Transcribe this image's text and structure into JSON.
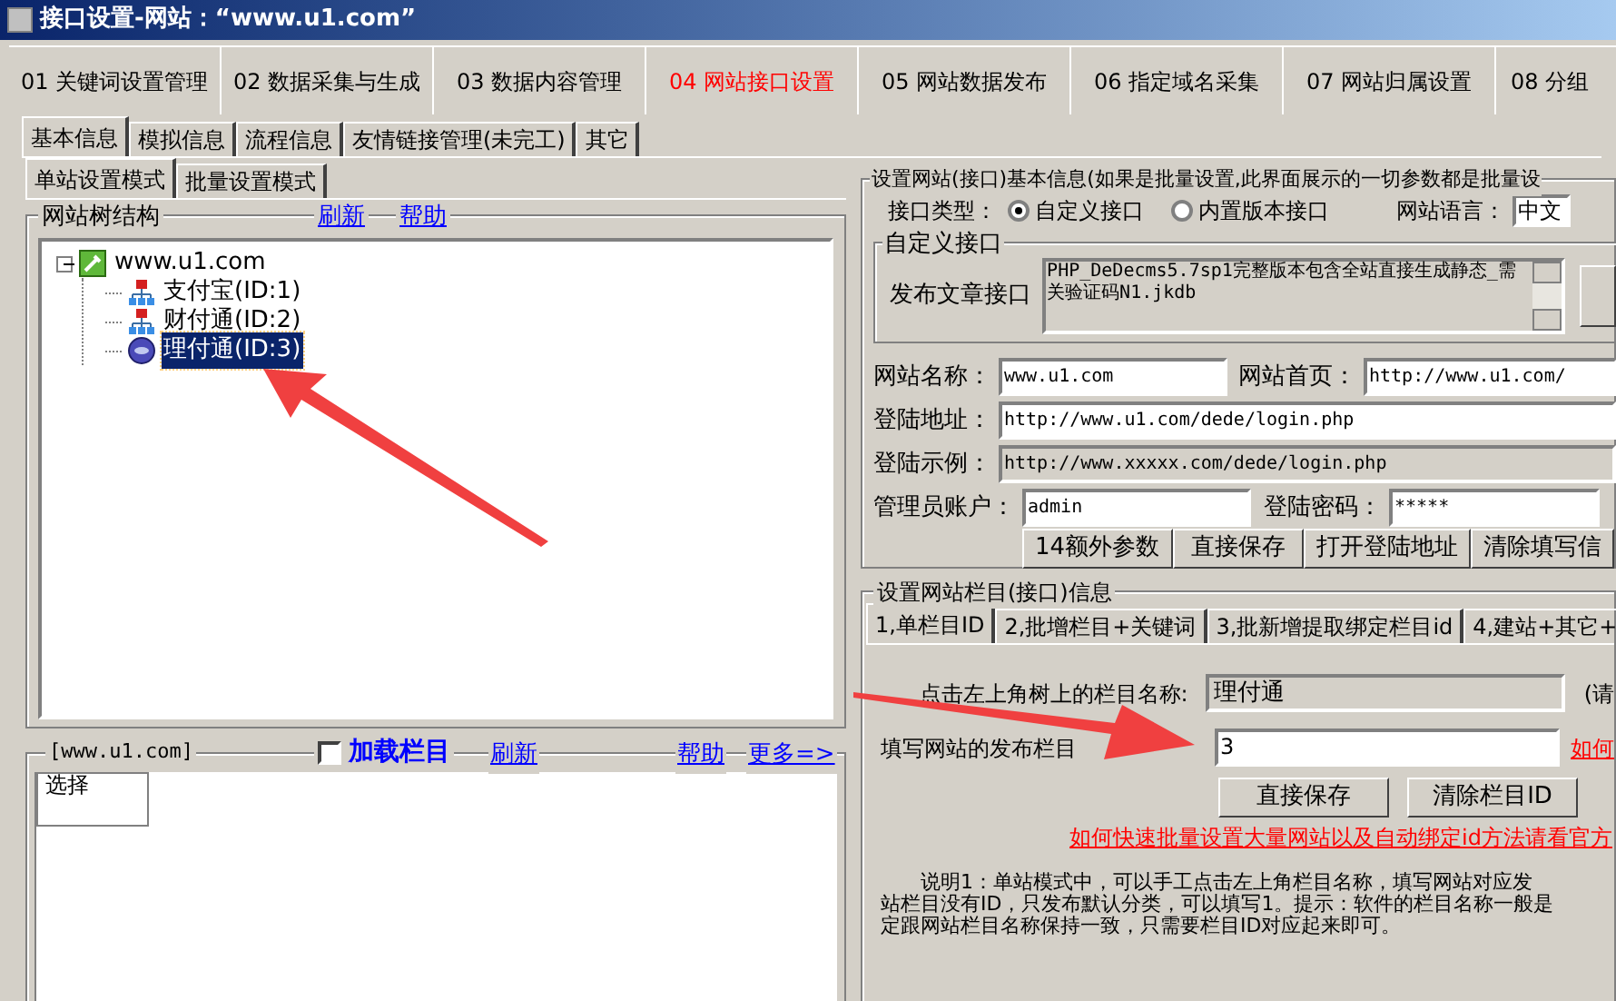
{
  "window": {
    "title": "接口设置-网站：“www.u1.com”"
  },
  "main_tabs": [
    {
      "label": "01 关键词设置管理",
      "selected": false
    },
    {
      "label": "02 数据采集与生成",
      "selected": false
    },
    {
      "label": "03 数据内容管理",
      "selected": false
    },
    {
      "label": "04 网站接口设置",
      "selected": true
    },
    {
      "label": "05 网站数据发布",
      "selected": false
    },
    {
      "label": "06 指定域名采集",
      "selected": false
    },
    {
      "label": "07 网站归属设置",
      "selected": false
    },
    {
      "label": "08 分组",
      "selected": false
    }
  ],
  "sub_tabs": [
    {
      "label": "基本信息",
      "selected": true
    },
    {
      "label": "模拟信息",
      "selected": false
    },
    {
      "label": "流程信息",
      "selected": false
    },
    {
      "label": "友情链接管理(未完工)",
      "selected": false
    },
    {
      "label": "其它",
      "selected": false
    }
  ],
  "mode_tabs": [
    {
      "label": "单站设置模式",
      "selected": true
    },
    {
      "label": "批量设置模式",
      "selected": false
    }
  ],
  "tree_panel": {
    "title": "网站树结构",
    "links": [
      "刷新",
      "帮助"
    ],
    "tree": [
      {
        "label": "www.u1.com",
        "kind": "site",
        "expanded": true,
        "selected": false,
        "children": [
          {
            "label": "支付宝(ID:1)",
            "kind": "category",
            "selected": false
          },
          {
            "label": "财付通(ID:2)",
            "kind": "category",
            "selected": false
          },
          {
            "label": "理付通(ID:3)",
            "kind": "globe",
            "selected": true
          }
        ]
      }
    ]
  },
  "column_panel": {
    "title": "[www.u1.com]",
    "load_checkbox": {
      "label": "加载栏目",
      "checked": false
    },
    "refresh_link": "刷新",
    "right_links": [
      "帮助",
      "更多=>"
    ],
    "list_header": "选择"
  },
  "basic_info": {
    "title": "设置网站(接口)基本信息(如果是批量设置,此界面展示的一切参数都是批量设",
    "interface_type_label": "接口类型：",
    "interface_types": [
      {
        "label": "自定义接口",
        "selected": true
      },
      {
        "label": "内置版本接口",
        "selected": false
      }
    ],
    "language_label": "网站语言：",
    "language": "中文",
    "custom_group": {
      "title": "自定义接口",
      "label": "发布文章接口",
      "value": "PHP_DeDecms5.7sp1完整版本包含全站直接生成静态_需关验证码N1.jkdb"
    },
    "rows": [
      {
        "fields": [
          {
            "label": "网站名称：",
            "value": "www.u1.com",
            "disabled": false
          },
          {
            "label": "网站首页：",
            "value": "http://www.u1.com/",
            "disabled": false
          }
        ]
      },
      {
        "fields": [
          {
            "label": "登陆地址：",
            "value": "http://www.u1.com/dede/login.php",
            "disabled": false
          }
        ]
      },
      {
        "fields": [
          {
            "label": "登陆示例：",
            "value": "http://www.xxxxx.com/dede/login.php",
            "disabled": true
          }
        ]
      },
      {
        "fields": [
          {
            "label": "管理员账户：",
            "value": "admin",
            "disabled": false
          },
          {
            "label": "登陆密码：",
            "value": "*****",
            "disabled": false
          }
        ]
      }
    ],
    "buttons": [
      "14额外参数",
      "直接保存",
      "打开登陆地址",
      "清除填写信"
    ]
  },
  "column_info": {
    "title": "设置网站栏目(接口)信息",
    "tabs": [
      {
        "label": "1,单栏目ID",
        "selected": true
      },
      {
        "label": "2,批增栏目+关键词",
        "selected": false
      },
      {
        "label": "3,批新增提取绑定栏目id",
        "selected": false
      },
      {
        "label": "4,建站+其它+",
        "selected": false
      }
    ],
    "name_label": "点击左上角树上的栏目名称:",
    "name_value": "理付通",
    "name_note": "(请",
    "id_label": "填写网站的发布栏目",
    "id_value": "3",
    "id_link": "如何",
    "buttons": [
      "直接保存",
      "清除栏目ID"
    ],
    "help_link": "如何快速批量设置大量网站以及自动绑定id方法请看官方",
    "description": [
      "说明1：单站模式中，可以手工点击左上角栏目名称，填写网站对应发",
      "站栏目没有ID，只发布默认分类，可以填写1。提示：软件的栏目名称一般是",
      "定跟网站栏目名称保持一致，只需要栏目ID对应起来即可。"
    ]
  }
}
